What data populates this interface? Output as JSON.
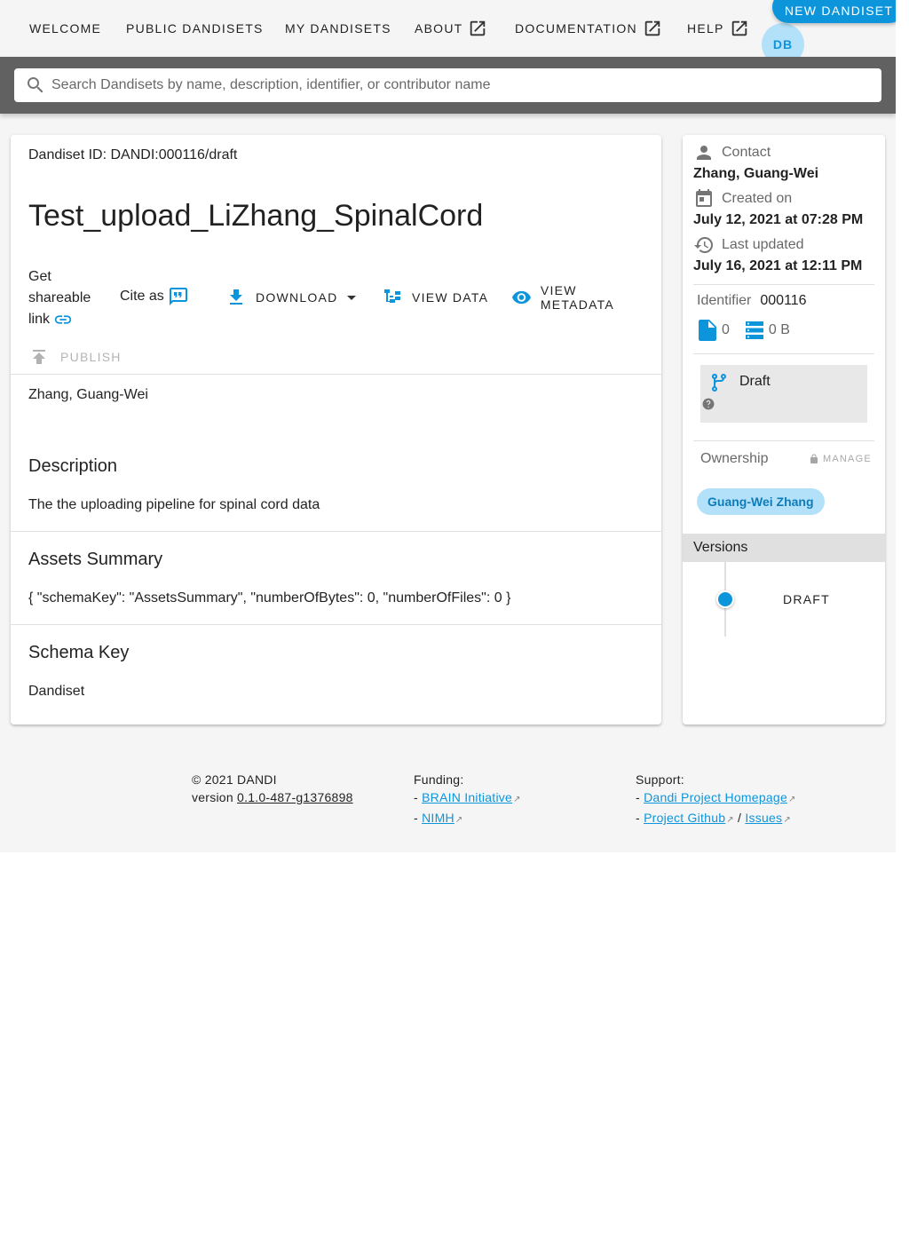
{
  "nav": {
    "items": [
      "WELCOME",
      "PUBLIC DANDISETS",
      "MY DANDISETS",
      "ABOUT",
      "DOCUMENTATION",
      "HELP"
    ],
    "new_button": "NEW DANDISET",
    "avatar": "DB"
  },
  "search": {
    "placeholder": "Search Dandisets by name, description, identifier, or contributor name"
  },
  "dandiset": {
    "id_line": "Dandiset ID: DANDI:000116/draft",
    "title": "Test_upload_LiZhang_SpinalCord",
    "share_lines": [
      "Get",
      "shareable",
      "link"
    ],
    "cite_label": "Cite as",
    "download_label": "DOWNLOAD",
    "view_data_label": "VIEW DATA",
    "view_metadata_label": "VIEW METADATA",
    "publish_label": "PUBLISH",
    "contributors": "Zhang, Guang-Wei",
    "sections": [
      {
        "title": "Description",
        "body": "The the uploading pipeline for spinal cord data"
      },
      {
        "title": "Assets Summary",
        "body": "{ \"schemaKey\": \"AssetsSummary\", \"numberOfBytes\": 0, \"numberOfFiles\": 0 }"
      },
      {
        "title": "Schema Key",
        "body": "Dandiset"
      }
    ]
  },
  "side": {
    "contact_label": "Contact",
    "contact_value": "Zhang, Guang-Wei",
    "created_label": "Created on",
    "created_value": "July 12, 2021 at 07:28 PM",
    "updated_label": "Last updated",
    "updated_value": "July 16, 2021 at 12:11 PM",
    "identifier_label": "Identifier",
    "identifier_value": "000116",
    "file_count": "0",
    "size": "0 B",
    "status": "Draft",
    "ownership_label": "Ownership",
    "manage_label": "MANAGE",
    "owner": "Guang-Wei Zhang",
    "versions_label": "Versions",
    "version": "DRAFT"
  },
  "footer": {
    "copyright": "© 2021 DANDI",
    "version_prefix": "version",
    "version": "0.1.0-487-g1376898",
    "funding_label": "Funding:",
    "funding_links": [
      "BRAIN Initiative",
      "NIMH"
    ],
    "support_label": "Support:",
    "support_links": [
      "Dandi Project Homepage",
      "Project Github",
      "Issues"
    ]
  },
  "colors": {
    "accent": "#0d95dc",
    "search_band": "#616161",
    "chip_bg": "#b3e1fa"
  }
}
